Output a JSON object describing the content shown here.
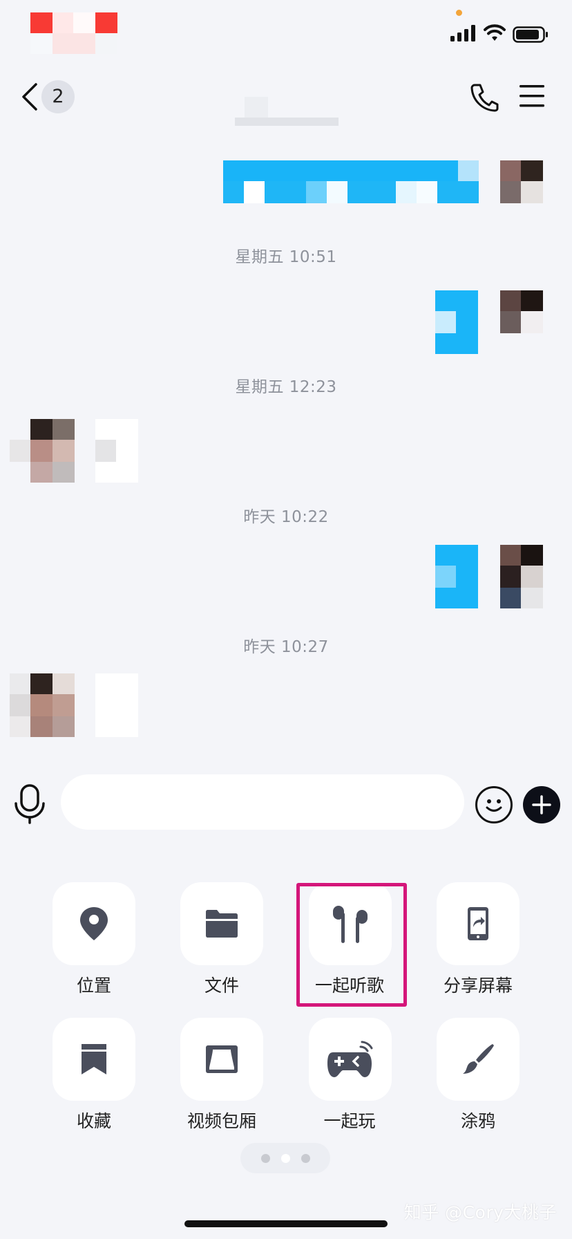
{
  "colors": {
    "accent": "#12b7f5",
    "highlight": "#d4167a",
    "icon": "#4a4e5c",
    "background": "#f4f5f9",
    "notification_dot": "#f3a53a"
  },
  "header": {
    "unread_count": "2",
    "icons": [
      "back-arrow-icon",
      "phone-icon",
      "menu-icon"
    ]
  },
  "messages": [
    {
      "time": "星期五 10:51"
    },
    {
      "time": "星期五 12:23"
    },
    {
      "time": "昨天 10:22"
    },
    {
      "time": "昨天 10:27"
    }
  ],
  "input": {
    "icons": [
      "microphone-icon",
      "emoji-icon",
      "plus-icon"
    ]
  },
  "functions": [
    {
      "label": "位置",
      "icon": "location-pin-icon"
    },
    {
      "label": "文件",
      "icon": "folder-icon"
    },
    {
      "label": "一起听歌",
      "icon": "earbuds-icon"
    },
    {
      "label": "分享屏幕",
      "icon": "share-screen-icon"
    },
    {
      "label": "收藏",
      "icon": "bookmark-icon"
    },
    {
      "label": "视频包厢",
      "icon": "video-room-icon"
    },
    {
      "label": "一起玩",
      "icon": "gamepad-icon"
    },
    {
      "label": "涂鸦",
      "icon": "paintbrush-icon"
    }
  ],
  "pager": {
    "pages": 3,
    "current": 2
  },
  "watermark": "知乎 @Cory大桃子"
}
